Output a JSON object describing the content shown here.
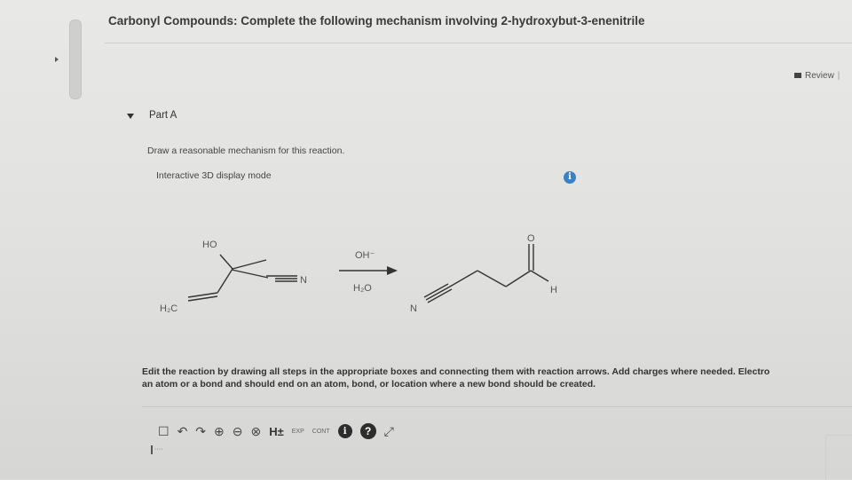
{
  "header": {
    "title": "Carbonyl Compounds: Complete the following mechanism involving 2-hydroxybut-3-enenitrile",
    "review_label": "Review",
    "review_sep": "|"
  },
  "part": {
    "label": "Part A",
    "instruction": "Draw a reasonable mechanism for this reaction.",
    "display_mode": "Interactive 3D display mode",
    "info_icon_glyph": "i"
  },
  "reaction": {
    "reactant_labels": {
      "hydroxyl": "HO",
      "methylene": "H₂C",
      "nitrile_n": "N"
    },
    "reagent_top": "OH⁻",
    "reagent_bottom": "H₂O",
    "product_labels": {
      "carbonyl_o": "O",
      "aldehyde_h": "H",
      "nitrile_n": "N"
    }
  },
  "editor": {
    "instruction": "Edit the reaction by drawing all steps in the appropriate boxes and connecting them with reaction arrows. Add charges where needed. Electrons should start at an atom or a bond and should end on an atom, bond, or location where a new bond should be created.",
    "instruction_line1": "Edit the reaction by drawing all steps in the appropriate boxes and connecting them with reaction arrows. Add charges where needed. Electro",
    "instruction_line2": "an atom or a bond and should end on an atom, bond, or location where a new bond should be created.",
    "toolbar": {
      "new_icon": "☐",
      "undo_icon": "↶",
      "redo_icon": "↷",
      "zoom_in_icon": "⊕",
      "zoom_out_icon": "⊖",
      "zoom_reset_icon": "⊗",
      "h_label": "H±",
      "exp_label": "EXP",
      "cont_label": "CONT",
      "info_glyph": "i",
      "help_glyph": "?",
      "fullscreen_icon": "⤢"
    },
    "caret_text": "····"
  }
}
